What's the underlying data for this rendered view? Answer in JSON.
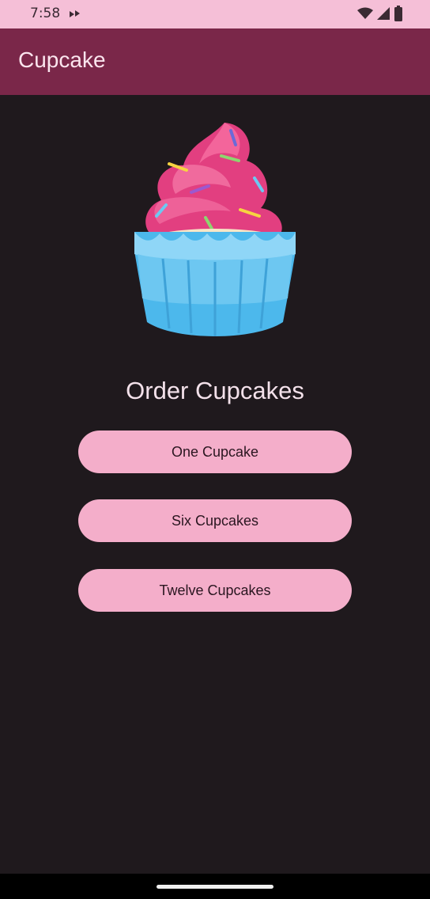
{
  "status_bar": {
    "time": "7:58",
    "icons": [
      "app-notification-icon",
      "wifi-icon",
      "cellular-signal-icon",
      "battery-icon"
    ]
  },
  "app_bar": {
    "title": "Cupcake"
  },
  "start_screen": {
    "hero_icon": "cupcake-icon",
    "heading": "Order Cupcakes",
    "options": [
      {
        "label": "One Cupcake"
      },
      {
        "label": "Six Cupcakes"
      },
      {
        "label": "Twelve Cupcakes"
      }
    ]
  },
  "colors": {
    "status_bar": "#f5bfd7",
    "app_bar": "#7a2749",
    "background": "#1f191d",
    "button": "#f4aeca",
    "button_text": "#2a1620"
  }
}
